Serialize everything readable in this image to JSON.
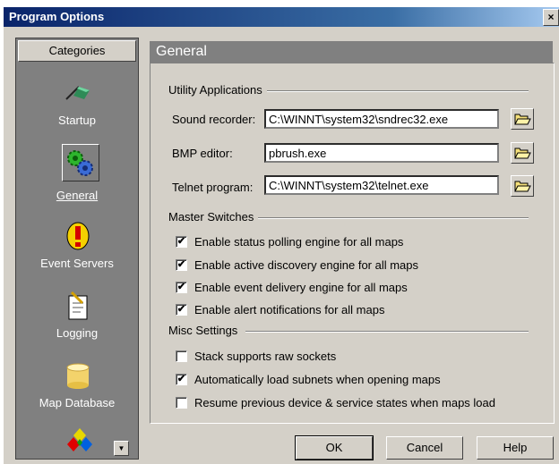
{
  "window": {
    "title": "Program Options",
    "close_glyph": "×"
  },
  "sidebar": {
    "header": "Categories",
    "items": [
      {
        "label": "Startup",
        "icon": "startup-icon"
      },
      {
        "label": "General",
        "icon": "gears-icon",
        "selected": true
      },
      {
        "label": "Event Servers",
        "icon": "alert-icon"
      },
      {
        "label": "Logging",
        "icon": "notepad-icon"
      },
      {
        "label": "Map Database",
        "icon": "database-icon"
      }
    ],
    "scroll_glyph": "▼"
  },
  "panel": {
    "title": "General",
    "utility": {
      "label": "Utility Applications",
      "fields": [
        {
          "label": "Sound recorder:",
          "value": "C:\\WINNT\\system32\\sndrec32.exe"
        },
        {
          "label": "BMP editor:",
          "value": "pbrush.exe"
        },
        {
          "label": "Telnet program:",
          "value": "C:\\WINNT\\system32\\telnet.exe"
        }
      ]
    },
    "master": {
      "label": "Master Switches",
      "items": [
        {
          "label": "Enable status polling engine for all maps",
          "checked": true
        },
        {
          "label": "Enable active discovery engine for all maps",
          "checked": true
        },
        {
          "label": "Enable event delivery engine for all maps",
          "checked": true
        },
        {
          "label": "Enable alert notifications for all maps",
          "checked": true
        }
      ]
    },
    "misc": {
      "label": "Misc Settings",
      "items": [
        {
          "label": "Stack supports raw sockets",
          "checked": false
        },
        {
          "label": "Automatically load subnets when opening maps",
          "checked": true
        },
        {
          "label": "Resume previous device & service states when maps load",
          "checked": false
        }
      ]
    }
  },
  "buttons": {
    "ok": "OK",
    "cancel": "Cancel",
    "help": "Help"
  },
  "check_glyph": "✔"
}
